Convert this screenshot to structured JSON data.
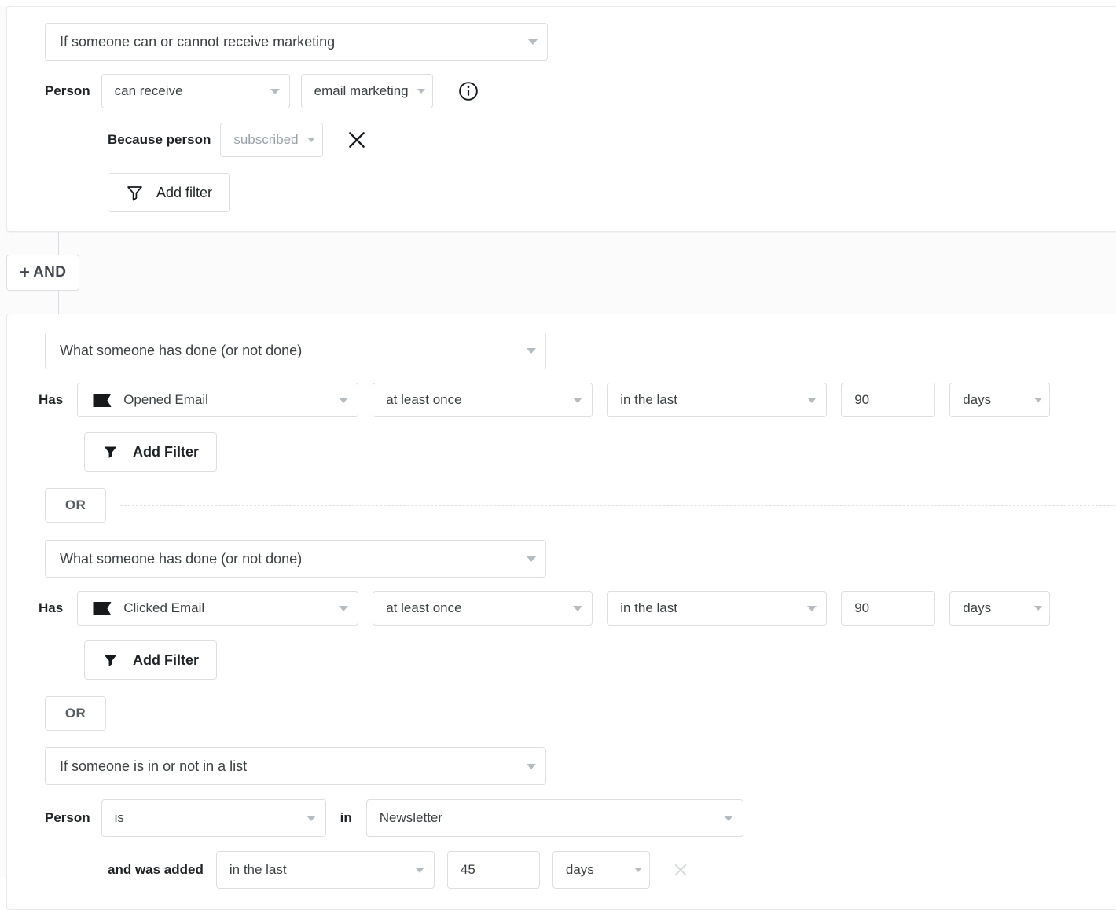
{
  "blocks": [
    {
      "type": "marketing",
      "condition_select": "If someone can or cannot receive marketing",
      "row1_label": "Person",
      "row1_select_a": "can receive",
      "row1_select_b": "email marketing",
      "info_icon": "info-circle-icon",
      "row2_label": "Because person",
      "row2_select": "subscribed",
      "remove_icon": "close-icon",
      "add_filter_label": "Add filter",
      "add_filter_icon": "funnel-outline-icon"
    }
  ],
  "and_button": {
    "label": "AND",
    "plus": "+",
    "icon": "plus-icon"
  },
  "group": {
    "sub_blocks": [
      {
        "type": "behavior",
        "condition_select": "What someone has done (or not done)",
        "label": "Has",
        "metric": "Opened Email",
        "metric_icon": "flag-icon",
        "frequency": "at least once",
        "timeframe": "in the last",
        "amount": "90",
        "unit": "days",
        "add_filter_label": "Add Filter",
        "add_filter_icon": "funnel-solid-icon"
      },
      {
        "divider": "OR"
      },
      {
        "type": "behavior",
        "condition_select": "What someone has done (or not done)",
        "label": "Has",
        "metric": "Clicked Email",
        "metric_icon": "flag-icon",
        "frequency": "at least once",
        "timeframe": "in the last",
        "amount": "90",
        "unit": "days",
        "add_filter_label": "Add Filter",
        "add_filter_icon": "funnel-solid-icon"
      },
      {
        "divider": "OR"
      },
      {
        "type": "list",
        "condition_select": "If someone is in or not in a list",
        "label": "Person",
        "operator": "is",
        "preposition": "in",
        "list_name": "Newsletter",
        "sub_label": "and was added",
        "timeframe": "in the last",
        "amount": "45",
        "unit": "days",
        "remove_icon": "close-icon"
      }
    ]
  },
  "colors": {
    "border": "#dcdfe2",
    "text": "#3c4144",
    "muted": "#9aa2a8",
    "caret": "#b4bcc2",
    "page_bg": "#fbfbfc"
  }
}
